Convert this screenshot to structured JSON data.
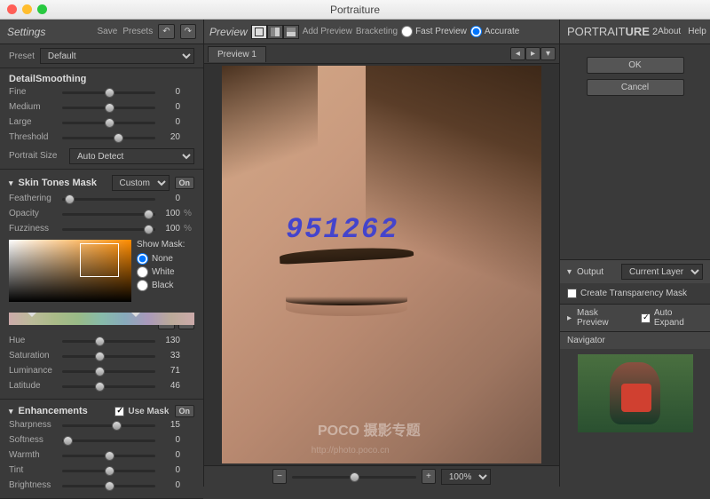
{
  "window": {
    "title": "Portraiture"
  },
  "left": {
    "header": {
      "title": "Settings",
      "save": "Save",
      "presets": "Presets"
    },
    "preset": {
      "label": "Preset",
      "value": "Default"
    },
    "detail": {
      "title": "DetailSmoothing",
      "sliders": [
        {
          "label": "Fine",
          "value": "0",
          "pos": 50
        },
        {
          "label": "Medium",
          "value": "0",
          "pos": 50
        },
        {
          "label": "Large",
          "value": "0",
          "pos": 50
        },
        {
          "label": "Threshold",
          "value": "20",
          "pos": 60
        }
      ],
      "portrait_size_label": "Portrait Size",
      "portrait_size_value": "Auto Detect"
    },
    "skin": {
      "title": "Skin Tones Mask",
      "mode": "Custom",
      "toggle": "On",
      "sliders1": [
        {
          "label": "Feathering",
          "value": "0",
          "pct": "",
          "pos": 8
        },
        {
          "label": "Opacity",
          "value": "100",
          "pct": "%",
          "pos": 92
        },
        {
          "label": "Fuzziness",
          "value": "100",
          "pct": "%",
          "pos": 92
        }
      ],
      "show_mask": "Show Mask:",
      "mask_opts": [
        "None",
        "White",
        "Black"
      ],
      "mask_selected": "None",
      "sliders2": [
        {
          "label": "Hue",
          "value": "130",
          "pos": 40
        },
        {
          "label": "Saturation",
          "value": "33",
          "pos": 40
        },
        {
          "label": "Luminance",
          "value": "71",
          "pos": 40
        },
        {
          "label": "Latitude",
          "value": "46",
          "pos": 40
        }
      ]
    },
    "enh": {
      "title": "Enhancements",
      "use_mask": "Use Mask",
      "toggle": "On",
      "sliders": [
        {
          "label": "Sharpness",
          "value": "15",
          "pos": 58
        },
        {
          "label": "Softness",
          "value": "0",
          "pos": 6
        },
        {
          "label": "Warmth",
          "value": "0",
          "pos": 50
        },
        {
          "label": "Tint",
          "value": "0",
          "pos": 50
        },
        {
          "label": "Brightness",
          "value": "0",
          "pos": 50
        }
      ]
    }
  },
  "center": {
    "header": {
      "title": "Preview",
      "add_preview": "Add Preview",
      "bracketing": "Bracketing",
      "fast": "Fast Preview",
      "accurate": "Accurate",
      "mode": "Accurate"
    },
    "tab": "Preview 1",
    "watermark": "951262",
    "watermark2": "POCO 摄影专题",
    "watermark3": "http://photo.poco.cn",
    "zoom": "100%"
  },
  "right": {
    "brand": "PORTRAITURE",
    "version": "2",
    "about": "About",
    "help": "Help",
    "ok": "OK",
    "cancel": "Cancel",
    "output": {
      "title": "Output",
      "mode": "Current Layer",
      "transparency": "Create Transparency Mask"
    },
    "mask_preview": {
      "title": "Mask Preview",
      "auto_expand": "Auto Expand"
    },
    "navigator": "Navigator"
  }
}
